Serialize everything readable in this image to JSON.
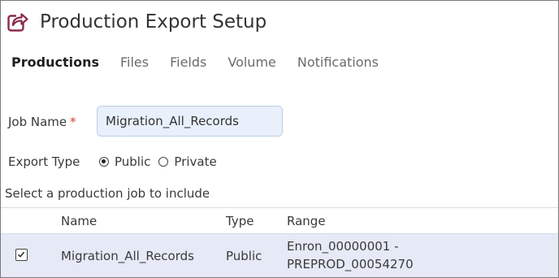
{
  "header": {
    "icon": "share-export-icon",
    "title": "Production Export Setup",
    "accent_color": "#8b2a4a"
  },
  "tabs": [
    {
      "label": "Productions",
      "active": true
    },
    {
      "label": "Files",
      "active": false
    },
    {
      "label": "Fields",
      "active": false
    },
    {
      "label": "Volume",
      "active": false
    },
    {
      "label": "Notifications",
      "active": false
    }
  ],
  "form": {
    "job_name_label": "Job Name",
    "required_marker": "*",
    "job_name_value": "Migration_All_Records",
    "export_type_label": "Export Type",
    "export_type_options": [
      {
        "label": "Public",
        "selected": true
      },
      {
        "label": "Private",
        "selected": false
      }
    ],
    "select_hint": "Select a production job to include"
  },
  "table": {
    "columns": [
      "Name",
      "Type",
      "Range"
    ],
    "rows": [
      {
        "checked": true,
        "name": "Migration_All_Records",
        "type": "Public",
        "range_line1": "Enron_00000001 -",
        "range_line2": "PREPROD_00054270"
      }
    ],
    "selected_row_color": "#e6e9f6"
  }
}
